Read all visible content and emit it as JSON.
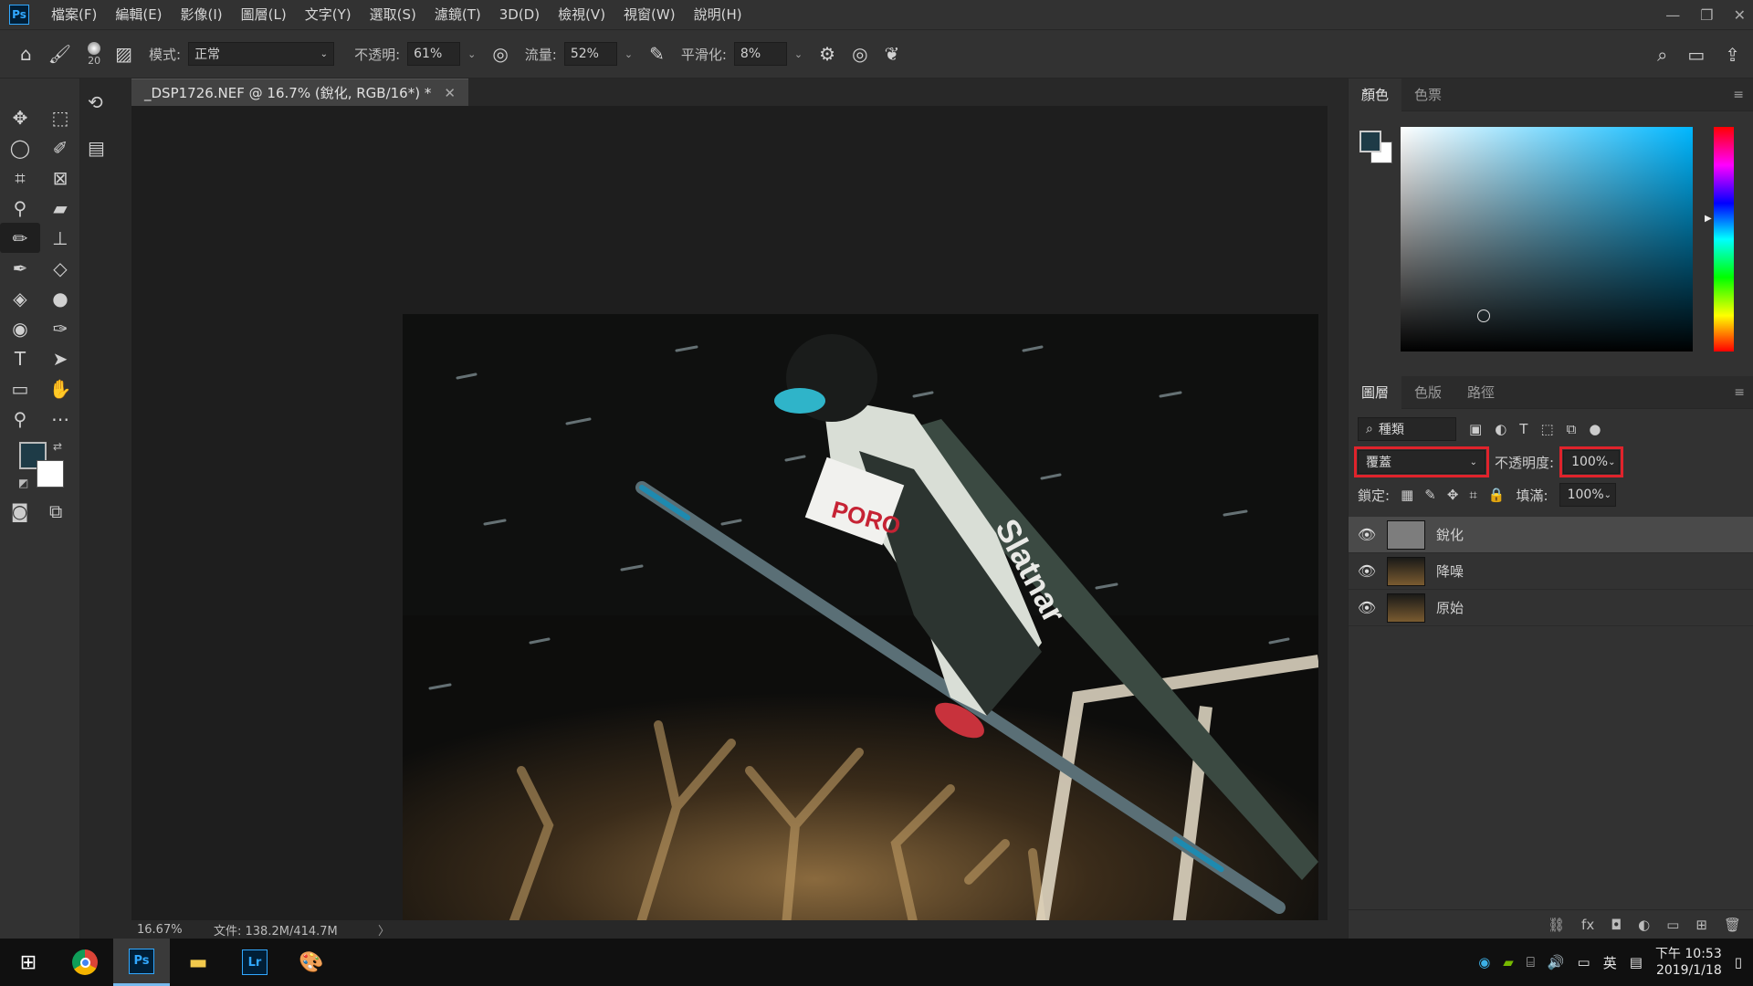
{
  "menubar": {
    "logo": "Ps",
    "items": [
      "檔案(F)",
      "編輯(E)",
      "影像(I)",
      "圖層(L)",
      "文字(Y)",
      "選取(S)",
      "濾鏡(T)",
      "3D(D)",
      "檢視(V)",
      "視窗(W)",
      "說明(H)"
    ]
  },
  "options": {
    "brush_size": "20",
    "mode_label": "模式:",
    "mode_value": "正常",
    "opacity_label": "不透明:",
    "opacity_value": "61%",
    "flow_label": "流量:",
    "flow_value": "52%",
    "smoothing_label": "平滑化:",
    "smoothing_value": "8%"
  },
  "document": {
    "tab_title": "_DSP1726.NEF @ 16.7% (銳化, RGB/16*) *",
    "zoom": "16.67%",
    "file_info": "文件: 138.2M/414.7M"
  },
  "color_panel": {
    "tabs": [
      "顏色",
      "色票"
    ],
    "fg_color": "#1e3b47",
    "bg_color": "#ffffff"
  },
  "layers_panel": {
    "tabs": [
      "圖層",
      "色版",
      "路徑"
    ],
    "filter_kind": "種類",
    "blend_mode": "覆蓋",
    "opacity_label": "不透明度:",
    "opacity_value": "100%",
    "lock_label": "鎖定:",
    "fill_label": "填滿:",
    "fill_value": "100%",
    "layers": [
      {
        "name": "銳化",
        "selected": true
      },
      {
        "name": "降噪",
        "selected": false
      },
      {
        "name": "原始",
        "selected": false
      }
    ]
  },
  "taskbar": {
    "apps": [
      "windows-start",
      "chrome",
      "photoshop",
      "file-explorer",
      "lightroom",
      "paint"
    ],
    "ime": "英",
    "time": "下午 10:53",
    "date": "2019/1/18"
  }
}
